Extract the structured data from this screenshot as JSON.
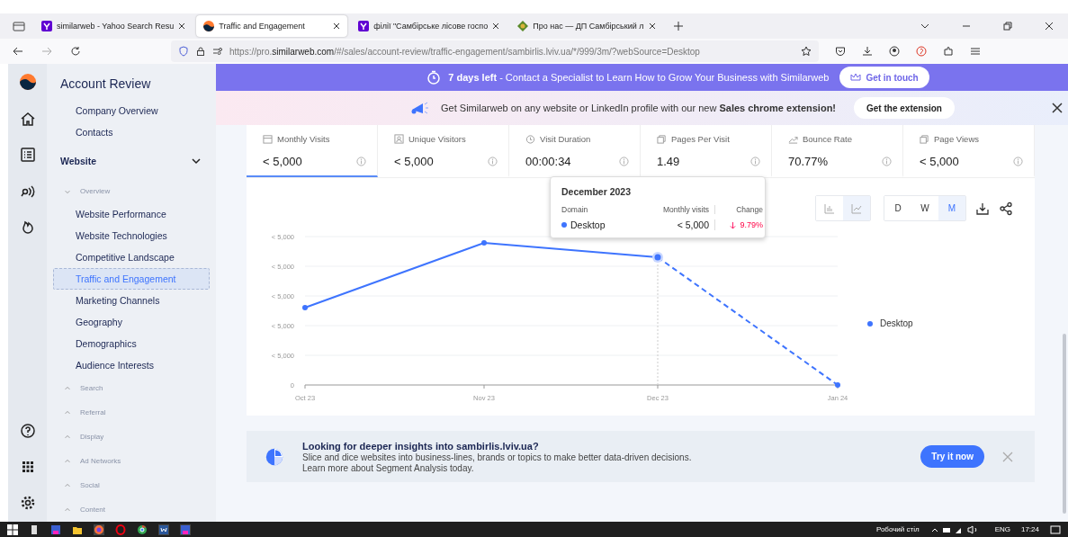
{
  "browser": {
    "tabs": [
      {
        "title": "similarweb - Yahoo Search Resu",
        "selected": false
      },
      {
        "title": "Traffic and Engagement",
        "selected": true
      },
      {
        "title": "філії \"Самбірське лісове госпо",
        "selected": false
      },
      {
        "title": "Про нас — ДП Самбірський л",
        "selected": false
      }
    ],
    "url_prefix": "https://pro.",
    "url_domain": "similarweb.com",
    "url_rest": "/#/sales/account-review/traffic-engagement/sambirlis.lviv.ua/*/999/3m/?webSource=Desktop"
  },
  "sidebar": {
    "title": "Account Review",
    "links": [
      {
        "label": "Company Overview"
      },
      {
        "label": "Contacts"
      }
    ],
    "section": {
      "label": "Website",
      "expanded": true,
      "groups": [
        {
          "label": "Overview",
          "expanded": true,
          "children": [
            {
              "label": "Website Performance",
              "selected": false
            },
            {
              "label": "Website Technologies",
              "selected": false
            },
            {
              "label": "Competitive Landscape",
              "selected": false
            },
            {
              "label": "Traffic and Engagement",
              "selected": true
            },
            {
              "label": "Marketing Channels",
              "selected": false
            },
            {
              "label": "Geography",
              "selected": false
            },
            {
              "label": "Demographics",
              "selected": false
            },
            {
              "label": "Audience Interests",
              "selected": false
            }
          ]
        },
        {
          "label": "Search",
          "expanded": false
        },
        {
          "label": "Referral",
          "expanded": false
        },
        {
          "label": "Display",
          "expanded": false
        },
        {
          "label": "Ad Networks",
          "expanded": false
        },
        {
          "label": "Social",
          "expanded": false
        },
        {
          "label": "Content",
          "expanded": false
        }
      ]
    }
  },
  "trial_banner": {
    "bold": "7 days left",
    "text": " - Contact a Specialist to Learn How to Grow Your Business with Similarweb",
    "button": "Get in touch"
  },
  "extension_banner": {
    "text": "Get Similarweb on any website or LinkedIn profile with our new **Sales chrome extension!**",
    "button": "Get the extension"
  },
  "metrics": [
    {
      "label": "Monthly Visits",
      "value": "< 5,000",
      "selected": true
    },
    {
      "label": "Unique Visitors",
      "value": "< 5,000",
      "selected": false
    },
    {
      "label": "Visit Duration",
      "value": "00:00:34",
      "selected": false
    },
    {
      "label": "Pages Per Visit",
      "value": "1.49",
      "selected": false
    },
    {
      "label": "Bounce Rate",
      "value": "70.77%",
      "selected": false
    },
    {
      "label": "Page Views",
      "value": "< 5,000",
      "selected": false
    }
  ],
  "chart_types": [
    {
      "kind": "bar",
      "selected": false
    },
    {
      "kind": "line",
      "selected": true
    }
  ],
  "granularity": [
    {
      "label": "D",
      "selected": false
    },
    {
      "label": "W",
      "selected": false
    },
    {
      "label": "M",
      "selected": true
    }
  ],
  "chart": {
    "y_labels": [
      "< 5,000",
      "< 5,000",
      "< 5,000",
      "< 5,000",
      "< 5,000",
      "0"
    ],
    "x_labels": [
      "Oct 23",
      "Nov 23",
      "Dec 23",
      "Jan 24"
    ],
    "legend": "Desktop"
  },
  "tooltip": {
    "title": "December 2023",
    "headers": [
      "Domain",
      "Monthly visits",
      "Change"
    ],
    "domain": "Desktop",
    "value": "< 5,000",
    "change": "9.79%"
  },
  "promo": {
    "title": "Looking for deeper insights into sambirlis.lviv.ua?",
    "line_1": "Slice and dice websites into business-lines, brands or topics to make better data-driven decisions.",
    "line_2": "Learn more about Segment Analysis today.",
    "button": "Try it now"
  },
  "taskbar": {
    "desktop": "Робочий стіл",
    "language": "ENG",
    "time": "17:24"
  }
}
